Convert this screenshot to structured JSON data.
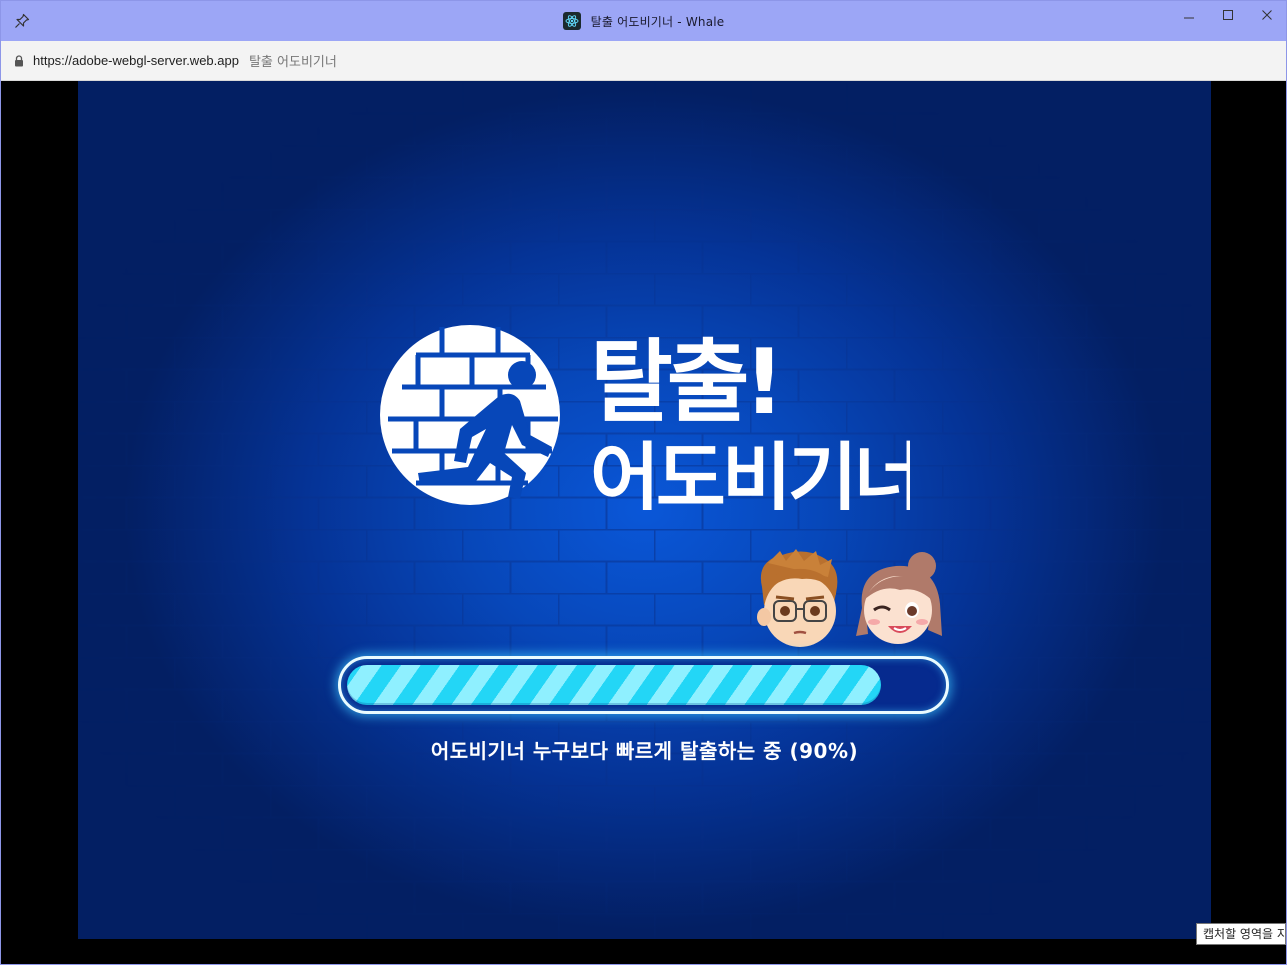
{
  "window": {
    "title": "탈출 어도비기너 - Whale",
    "controls": {
      "minimize": "minimize-icon",
      "maximize": "maximize-icon",
      "close": "close-icon"
    }
  },
  "addressbar": {
    "url": "https://adobe-webgl-server.web.app",
    "page_title": "탈출 어도비기너"
  },
  "game": {
    "logo": {
      "line1": "탈출!",
      "line2": "어도비기너"
    },
    "progress": {
      "percent": 90,
      "label": "어도비기너 누구보다 빠르게 탈출하는 중 (90%)"
    },
    "colors": {
      "background": "#0747b9",
      "progress_fill": "#23d6f6",
      "progress_stripe": "#8ff0ff",
      "track_border": "#e9fbff"
    }
  },
  "capture_tooltip": "캡처할 영역을 지"
}
